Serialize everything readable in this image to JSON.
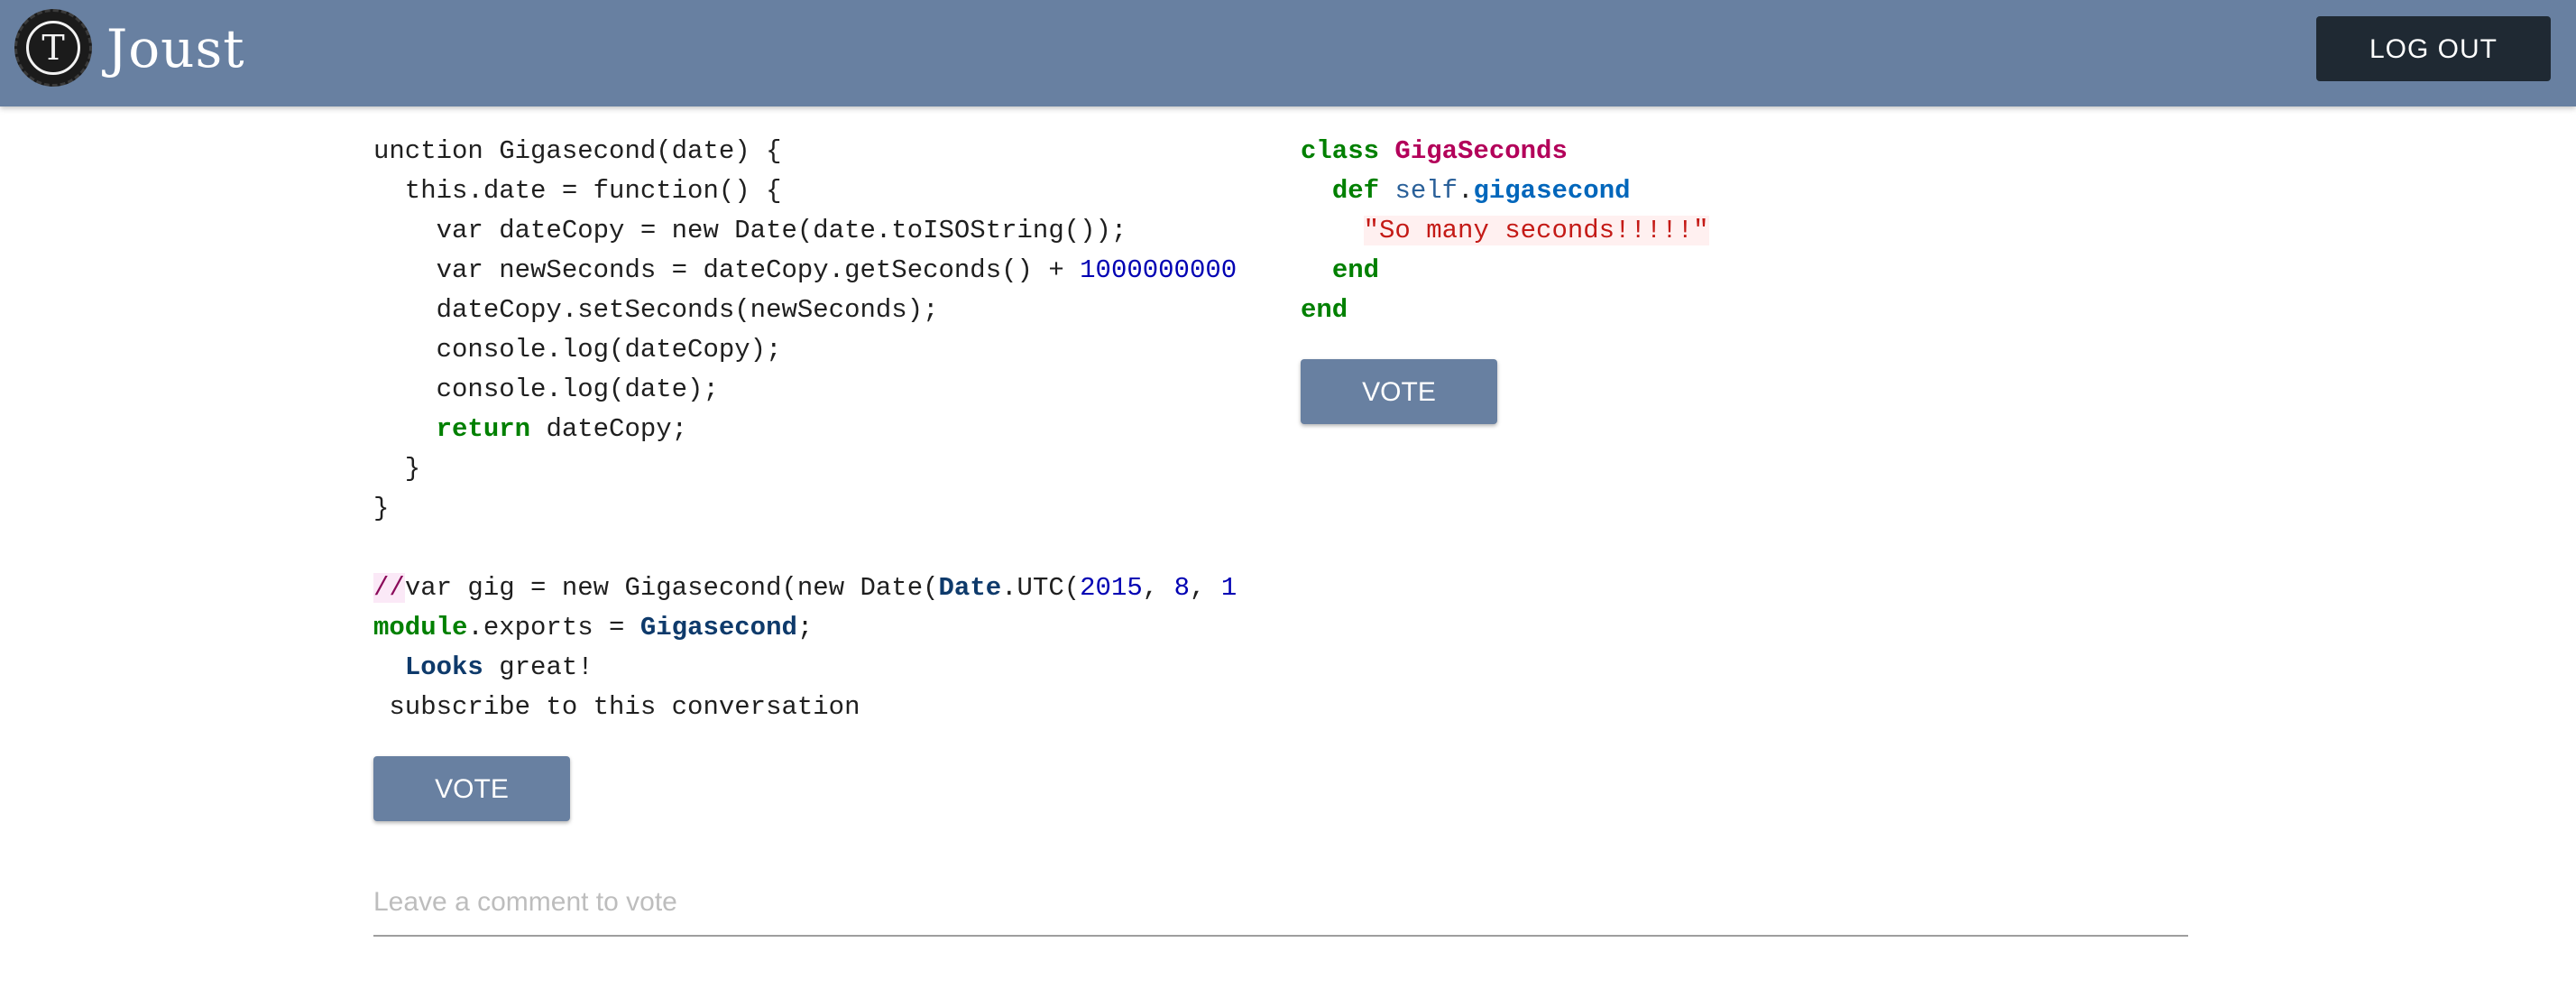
{
  "header": {
    "logo_letter": "T",
    "brand": "Joust",
    "logout_label": "LOG OUT"
  },
  "left_submission": {
    "code_lines": [
      [
        {
          "t": "unction Gigasecond(date) {"
        }
      ],
      [
        {
          "t": "  this.date = function() {"
        }
      ],
      [
        {
          "t": "    var dateCopy = new Date(date.toISOString());"
        }
      ],
      [
        {
          "t": "    var newSeconds = dateCopy.getSeconds() + "
        },
        {
          "t": "1000000000",
          "c": "num"
        }
      ],
      [
        {
          "t": "    dateCopy.setSeconds(newSeconds);"
        }
      ],
      [
        {
          "t": "    console.log(dateCopy);"
        }
      ],
      [
        {
          "t": "    console.log(date);"
        }
      ],
      [
        {
          "t": "    "
        },
        {
          "t": "return",
          "c": "kw"
        },
        {
          "t": " dateCopy;"
        }
      ],
      [
        {
          "t": "  }"
        }
      ],
      [
        {
          "t": "}"
        }
      ],
      [
        {
          "t": ""
        }
      ],
      [
        {
          "t": "//",
          "c": "cmt-mark"
        },
        {
          "t": "var gig = new Gigasecond(new Date("
        },
        {
          "t": "Date",
          "c": "bold-blue"
        },
        {
          "t": ".UTC("
        },
        {
          "t": "2015",
          "c": "num"
        },
        {
          "t": ", "
        },
        {
          "t": "8",
          "c": "num"
        },
        {
          "t": ", "
        },
        {
          "t": "1",
          "c": "num"
        }
      ],
      [
        {
          "t": "module",
          "c": "mod"
        },
        {
          "t": ".exports = "
        },
        {
          "t": "Gigasecond",
          "c": "bold-blue"
        },
        {
          "t": ";"
        }
      ],
      [
        {
          "t": "  "
        },
        {
          "t": "Looks",
          "c": "bold-blue"
        },
        {
          "t": " great!"
        }
      ],
      [
        {
          "t": " subscribe to this conversation"
        }
      ]
    ],
    "vote_label": "VOTE"
  },
  "right_submission": {
    "code_lines": [
      [
        {
          "t": "class",
          "c": "kw"
        },
        {
          "t": " "
        },
        {
          "t": "GigaSeconds",
          "c": "cls"
        }
      ],
      [
        {
          "t": "  "
        },
        {
          "t": "def",
          "c": "kw"
        },
        {
          "t": " "
        },
        {
          "t": "self",
          "c": "slf"
        },
        {
          "t": "."
        },
        {
          "t": "gigasecond",
          "c": "fn"
        }
      ],
      [
        {
          "t": "    "
        },
        {
          "t": "\"So many seconds!!!!!\"",
          "c": "str"
        }
      ],
      [
        {
          "t": "  "
        },
        {
          "t": "end",
          "c": "kw"
        }
      ],
      [
        {
          "t": "end",
          "c": "kw"
        }
      ]
    ],
    "vote_label": "VOTE"
  },
  "comment": {
    "placeholder": "Leave a comment to vote",
    "value": ""
  },
  "colors": {
    "header_bg": "#6880a1",
    "logout_bg": "#1f2933",
    "vote_bg": "#6880a1"
  }
}
